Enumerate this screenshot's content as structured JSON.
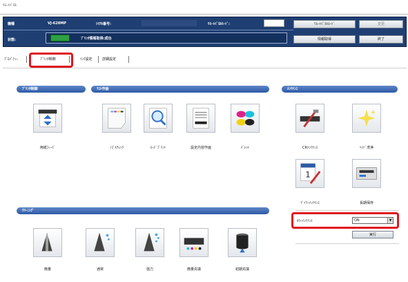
{
  "window_title": "ﾘﾓｰﾄﾊﾟﾈﾙ",
  "info": {
    "model_label": "機種",
    "model_value": "VJ-628MP",
    "serial_label": "ｼﾘｱﾙ番号:",
    "panel_label": "ﾘﾓｰﾄﾊﾟﾈﾙﾓｰﾄﾞ:",
    "state_label": "状態:",
    "state_value": "ﾌﾟﾘﾝﾀ情報取得:成功"
  },
  "buttons": {
    "remote_panel_mode": "ﾘﾓｰﾄﾊﾟﾈﾙﾓｰﾄﾞ",
    "change": "変更",
    "get_info": "情報取得",
    "exit": "終了",
    "execute": "実行"
  },
  "tabs": [
    "ﾌﾟﾛﾊﾟﾃｨｰ",
    "ﾌﾟﾘﾝﾀ制御",
    "ｲﾝｸ設定",
    "詳細設定"
  ],
  "sections": {
    "printer_control": "ﾌﾟﾘﾝﾀ制御",
    "test_print": "ﾃｽﾄ作画",
    "maintenance": "ﾒﾝﾃﾅﾝｽ",
    "cleaning": "ｸﾘｰﾆﾝｸﾞ"
  },
  "icons": {
    "media_feed": "用紙ﾌｨｰﾄﾞ",
    "nozzle_check": "ﾉｽﾞﾙﾁｪｯｸ",
    "mode_print": "ﾓｰﾄﾞﾌﾟﾘﾝﾄ",
    "settings_print": "設定内容作画",
    "palette": "ﾊﾟﾚｯﾄ",
    "cr_maintenance": "CRﾒﾝﾃﾅﾝｽ",
    "head_wash": "ﾍｯﾄﾞ洗浄",
    "daily_maintenance": "ﾃﾞｲﾘｰﾒﾝﾃﾅﾝｽ",
    "long_storage": "長期保存",
    "clean_light": "微量",
    "clean_normal": "通常",
    "clean_strong": "強力",
    "ink_fill_small": "微量充填",
    "initial_fill": "初期充填"
  },
  "color_maintenance": {
    "label": "ｶﾗｰﾒﾝﾃﾅﾝｽ",
    "value": "ON"
  },
  "colors": {
    "panel_bg": "#1f3f73",
    "pill_blue": "#2d5aa5",
    "highlight_red": "#e0141e",
    "status_green": "#2ea043"
  }
}
